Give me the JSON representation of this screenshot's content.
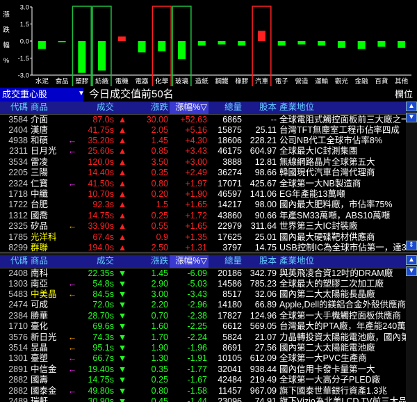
{
  "chart_data": {
    "type": "bar",
    "ylabel": "漲跌幅%",
    "ylim": [
      -3.0,
      3.0
    ],
    "yticks": [
      "3.0",
      "1.5",
      "0.0",
      "-1.5",
      "-3.0"
    ],
    "categories": [
      "水泥",
      "食品",
      "塑膠",
      "紡織",
      "電機",
      "電器",
      "化學",
      "玻璃",
      "造紙",
      "鋼鐵",
      "橡膠",
      "汽車",
      "電子",
      "營造",
      "運輸",
      "觀光",
      "金融",
      "百貨",
      "其他"
    ],
    "values": [
      -0.7,
      -0.1,
      -2.8,
      -2.6,
      0.4,
      -1.0,
      -0.9,
      -1.6,
      -0.4,
      -0.3,
      -0.4,
      0.9,
      -0.4,
      -0.3,
      -0.4,
      -0.6,
      -0.7,
      -0.5,
      -0.6
    ],
    "highlight_red": [
      "化學",
      "汽車"
    ],
    "highlight_green": [
      "塑膠",
      "紡織",
      "玻璃"
    ],
    "colors": {
      "up": "#ff2020",
      "down": "#00ff00",
      "frame_red": "#ff2020",
      "frame_green": "#20c040"
    }
  },
  "title": {
    "left": "成交重心股",
    "main": "今日成交值前50名",
    "right": "欄位"
  },
  "headers": [
    "代碼",
    "商品",
    "",
    "成交",
    "",
    "漲跌",
    "漲幅%",
    "總量",
    "股本",
    "產業地位"
  ],
  "top_rows": [
    {
      "code": "3584",
      "name": "介面",
      "mark": "",
      "price": "87.0",
      "pf": "s",
      "dir": "▲",
      "chg": "30.00",
      "pct": "+52.63",
      "vol": "6865",
      "cap": "--",
      "desc": "全球電阻式觸控面板前三大廠之一",
      "color": "red"
    },
    {
      "code": "2404",
      "name": "漢唐",
      "mark": "",
      "price": "41.75",
      "pf": "s",
      "dir": "▲",
      "chg": "2.05",
      "pct": "+5.16",
      "vol": "15875",
      "cap": "25.11",
      "desc": "台灣TFT無塵室工程市佔率四成",
      "color": "red"
    },
    {
      "code": "4938",
      "name": "和碩",
      "mark": "magenta",
      "price": "35.20",
      "pf": "s",
      "dir": "▲",
      "chg": "1.45",
      "pct": "+4.30",
      "vol": "18606",
      "cap": "228.21",
      "desc": "公司NB代工全球市佔率8%",
      "color": "red"
    },
    {
      "code": "2311",
      "name": "日月光",
      "mark": "magenta",
      "price": "25.60",
      "pf": "s",
      "dir": "▲",
      "chg": "0.85",
      "pct": "+3.43",
      "vol": "46175",
      "cap": "604.97",
      "desc": "全球最大IC封測集團",
      "color": "red"
    },
    {
      "code": "3534",
      "name": "雷凌",
      "mark": "",
      "price": "120.0",
      "pf": "s",
      "dir": "▲",
      "chg": "3.50",
      "pct": "+3.00",
      "vol": "3888",
      "cap": "12.81",
      "desc": "無線網路晶片全球第五大",
      "color": "red"
    },
    {
      "code": "2205",
      "name": "三陽",
      "mark": "",
      "price": "14.40",
      "pf": "s",
      "dir": "▲",
      "chg": "0.35",
      "pct": "+2.49",
      "vol": "36274",
      "cap": "98.66",
      "desc": "韓國現代汽車台灣代理商",
      "color": "red"
    },
    {
      "code": "2324",
      "name": "仁寶",
      "mark": "magenta",
      "price": "41.50",
      "pf": "s",
      "dir": "▲",
      "chg": "0.80",
      "pct": "+1.97",
      "vol": "17071",
      "cap": "425.67",
      "desc": "全球第一大NB製造商",
      "color": "red"
    },
    {
      "code": "1718",
      "name": "中纖",
      "mark": "",
      "price": "10.70",
      "pf": "s",
      "dir": "▲",
      "chg": "0.20",
      "pct": "+1.90",
      "vol": "46597",
      "cap": "141.06",
      "desc": "EG年產能13萬噸",
      "color": "red"
    },
    {
      "code": "1722",
      "name": "台肥",
      "mark": "",
      "price": "92.3",
      "pf": "s",
      "dir": "▲",
      "chg": "1.5",
      "pct": "+1.65",
      "vol": "14217",
      "cap": "98.00",
      "desc": "國內最大肥料廠，市佔率75%",
      "color": "red"
    },
    {
      "code": "1312",
      "name": "國喬",
      "mark": "",
      "price": "14.75",
      "pf": "s",
      "dir": "▲",
      "chg": "0.25",
      "pct": "+1.72",
      "vol": "43860",
      "cap": "90.66",
      "desc": "年產SM33萬噸，ABS10萬噸",
      "color": "red"
    },
    {
      "code": "2325",
      "name": "矽品",
      "mark": "orange",
      "price": "33.90",
      "pf": "s",
      "dir": "▲",
      "chg": "0.55",
      "pct": "+1.65",
      "vol": "22979",
      "cap": "311.64",
      "desc": "世界第三大IC封裝廠",
      "color": "red"
    },
    {
      "code": "1785",
      "name": "光洋科",
      "mark": "",
      "price": "67.4",
      "pf": "s",
      "dir": "▲",
      "chg": "0.9",
      "pct": "+1.35",
      "vol": "17625",
      "cap": "25.01",
      "desc": "國內最大硬碟靶材供應商",
      "color": "red",
      "namecolor": "yel"
    },
    {
      "code": "8299",
      "name": "群聯",
      "mark": "",
      "price": "194.0",
      "pf": "s",
      "dir": "▲",
      "chg": "2.50",
      "pct": "+1.31",
      "vol": "3797",
      "cap": "14.75",
      "desc": "USB控制IC為全球市佔第一，達31...",
      "color": "red",
      "namecolor": "yel"
    }
  ],
  "bottom_rows": [
    {
      "code": "2408",
      "name": "南科",
      "mark": "",
      "price": "22.35",
      "pf": "s",
      "dir": "▼",
      "chg": "1.45",
      "pct": "-6.09",
      "vol": "20186",
      "cap": "342.79",
      "desc": "與英飛凌合資12吋的DRAM廠",
      "color": "grn"
    },
    {
      "code": "1303",
      "name": "南亞",
      "mark": "magenta",
      "price": "54.8",
      "pf": "s",
      "dir": "▼",
      "chg": "2.90",
      "pct": "-5.03",
      "vol": "14586",
      "cap": "785.23",
      "desc": "全球最大的塑膠二次加工廠",
      "color": "grn"
    },
    {
      "code": "5483",
      "name": "中美晶",
      "mark": "orange",
      "price": "84.5",
      "pf": "s",
      "dir": "▼",
      "chg": "3.00",
      "pct": "-3.43",
      "vol": "8517",
      "cap": "32.06",
      "desc": "國內第二大太陽能長晶廠",
      "color": "grn",
      "namecolor": "yel"
    },
    {
      "code": "2474",
      "name": "可成",
      "mark": "",
      "price": "72.0",
      "pf": "s",
      "dir": "▼",
      "chg": "2.20",
      "pct": "-2.96",
      "vol": "14180",
      "cap": "66.89",
      "desc": "Apple,Dell的鎂鋁合金外殼供應商",
      "color": "grn"
    },
    {
      "code": "2384",
      "name": "勝華",
      "mark": "",
      "price": "28.70",
      "pf": "s",
      "dir": "▼",
      "chg": "0.70",
      "pct": "-2.38",
      "vol": "17827",
      "cap": "124.96",
      "desc": "全球第一大手機觸控面板供應商",
      "color": "grn"
    },
    {
      "code": "1710",
      "name": "臺化",
      "mark": "",
      "price": "69.6",
      "pf": "s",
      "dir": "▼",
      "chg": "1.60",
      "pct": "-2.25",
      "vol": "6612",
      "cap": "569.05",
      "desc": "台灣最大的PTA廠，年產能240萬噸",
      "color": "grn"
    },
    {
      "code": "3576",
      "name": "新日光",
      "mark": "orange",
      "price": "74.3",
      "pf": "s",
      "dir": "▼",
      "chg": "1.70",
      "pct": "-2.24",
      "vol": "5824",
      "cap": "21.07",
      "desc": "力晶轉投資太陽能電池廠，國內第...",
      "color": "grn"
    },
    {
      "code": "3514",
      "name": "昱晶",
      "mark": "orange",
      "price": "95.1",
      "pf": "s",
      "dir": "▼",
      "chg": "1.90",
      "pct": "-1.96",
      "vol": "8691",
      "cap": "27.56",
      "desc": "國內第二大太陽能電池廠",
      "color": "grn"
    },
    {
      "code": "1301",
      "name": "臺塑",
      "mark": "magenta",
      "price": "66.7",
      "pf": "s",
      "dir": "▼",
      "chg": "1.30",
      "pct": "-1.91",
      "vol": "10105",
      "cap": "612.09",
      "desc": "全球第一大PVC生產商",
      "color": "grn"
    },
    {
      "code": "2891",
      "name": "中信金",
      "mark": "magenta",
      "price": "19.40",
      "pf": "s",
      "dir": "▼",
      "chg": "0.35",
      "pct": "-1.77",
      "vol": "32041",
      "cap": "938.44",
      "desc": "國內信用卡發卡量第一大",
      "color": "grn"
    },
    {
      "code": "2882",
      "name": "國壽",
      "mark": "",
      "price": "14.75",
      "pf": "s",
      "dir": "▼",
      "chg": "0.25",
      "pct": "-1.67",
      "vol": "42484",
      "cap": "219.49",
      "desc": "全球第一大高分子PLED廠",
      "color": "grn"
    },
    {
      "code": "2882",
      "name": "國泰金",
      "mark": "magenta",
      "price": "49.80",
      "pf": "s",
      "dir": "▼",
      "chg": "0.80",
      "pct": "-1.58",
      "vol": "11457",
      "cap": "967.09",
      "desc": "旗下國泰世華銀行資產1.3兆",
      "color": "grn"
    },
    {
      "code": "2489",
      "name": "瑞軒",
      "mark": "",
      "price": "30.90",
      "pf": "s",
      "dir": "▼",
      "chg": "0.45",
      "pct": "-1.44",
      "vol": "23096",
      "cap": "74.91",
      "desc": "旗下Vizio為北美LCD TV前三大品牌",
      "color": "grn"
    }
  ],
  "scroll": {
    "up": "▲",
    "down": "▼",
    "expand": "⇕"
  },
  "arrows": {
    "magenta": "←",
    "orange": "←"
  }
}
